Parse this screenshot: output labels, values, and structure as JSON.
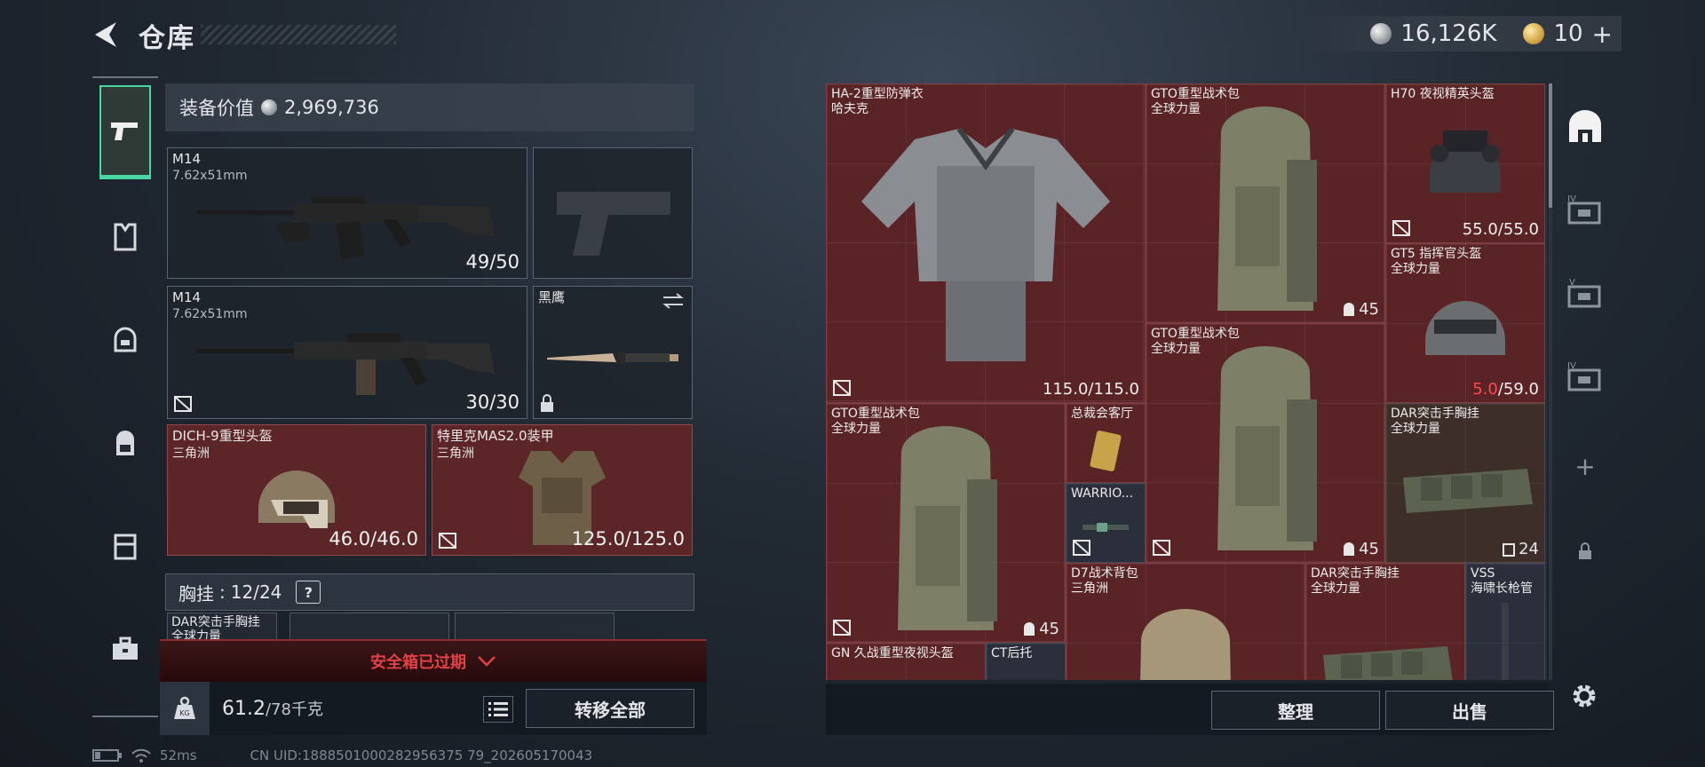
{
  "header": {
    "title": "仓库",
    "currency_silver": "16,126K",
    "currency_gold": "10",
    "gold_add": "+"
  },
  "left_nav": {
    "items": [
      {
        "icon": "pistol-icon",
        "active": true
      },
      {
        "icon": "armor-vest-icon"
      },
      {
        "icon": "helmet-icon"
      },
      {
        "icon": "backpack-icon"
      },
      {
        "icon": "chest-rig-icon"
      },
      {
        "icon": "toolbox-icon"
      }
    ]
  },
  "equipment": {
    "value_label": "装备价值",
    "value": "2,969,736",
    "primary1": {
      "name": "M14",
      "caliber": "7.62x51mm",
      "ammo": "49/50"
    },
    "primary2": {
      "name": "M14",
      "caliber": "7.62x51mm",
      "ammo": "30/30"
    },
    "melee": {
      "name": "黑鹰"
    },
    "helmet": {
      "name": "DICH-9重型头盔",
      "origin": "三角洲",
      "durability": "46.0/46.0"
    },
    "armor": {
      "name": "特里克MAS2.0装甲",
      "origin": "三角洲",
      "durability": "125.0/125.0"
    },
    "chest_label": "胸挂",
    "chest_value": "12/24",
    "chest_help": "?",
    "chest_sub1": "DAR突击手胸挂",
    "chest_sub1b": "全球力量"
  },
  "safe_box": {
    "expired_text": "安全箱已过期"
  },
  "bottom": {
    "weight_current": "61.2",
    "weight_max": "/78千克",
    "transfer_all": "转移全部"
  },
  "status": {
    "ping": "52ms",
    "uid": "CN UID:1888501000282956375 79_202605170043"
  },
  "stash": {
    "items": [
      {
        "name": "HA-2重型防弹衣",
        "sub": "哈夫克",
        "value": "115.0/115.0"
      },
      {
        "name": "GTO重型战术包",
        "sub": "全球力量",
        "count": "45"
      },
      {
        "name": "H70 夜视精英头盔",
        "value": "55.0/55.0"
      },
      {
        "name": "GT5 指挥官头盔",
        "sub": "全球力量",
        "value_low": "5.0",
        "value_max": "/59.0"
      },
      {
        "name": "GTO重型战术包",
        "sub": "全球力量",
        "count": "45"
      },
      {
        "name": "GTO重型战术包",
        "sub": "全球力量",
        "count": "45"
      },
      {
        "name": "总裁会客厅"
      },
      {
        "name": "WARRIO..."
      },
      {
        "name": "DAR突击手胸挂",
        "sub": "全球力量",
        "count": "24"
      },
      {
        "name": "D7战术背包",
        "sub": "三角洲"
      },
      {
        "name": "DAR突击手胸挂",
        "sub": "全球力量"
      },
      {
        "name": "VSS",
        "sub": "海啸长枪管"
      },
      {
        "name": "GN 久战重型夜视头盔"
      },
      {
        "name": "CT后托"
      }
    ],
    "sort_label": "整理",
    "sell_label": "出售"
  },
  "right_tabs": [
    {
      "icon": "stash-home-icon",
      "label": ""
    },
    {
      "icon": "case-tier-iv-icon",
      "label": "IV"
    },
    {
      "icon": "case-tier-v-icon",
      "label": "V"
    },
    {
      "icon": "case-tier-iv-icon",
      "label": "IV"
    },
    {
      "icon": "add-icon",
      "label": "+"
    },
    {
      "icon": "lock-icon",
      "label": ""
    }
  ]
}
